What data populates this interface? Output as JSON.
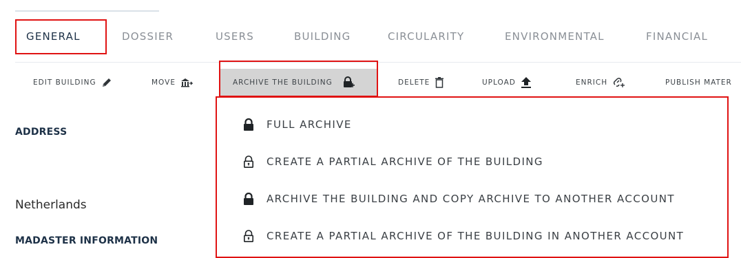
{
  "tabs": [
    {
      "label": "GENERAL",
      "active": true
    },
    {
      "label": "DOSSIER",
      "active": false
    },
    {
      "label": "USERS",
      "active": false
    },
    {
      "label": "BUILDING",
      "active": false
    },
    {
      "label": "CIRCULARITY",
      "active": false
    },
    {
      "label": "ENVIRONMENTAL",
      "active": false
    },
    {
      "label": "FINANCIAL",
      "active": false
    }
  ],
  "toolbar": {
    "edit_building": {
      "label": "EDIT BUILDING",
      "icon": "pencil-icon"
    },
    "move": {
      "label": "MOVE",
      "icon": "move-building-icon"
    },
    "archive": {
      "label": "ARCHIVE THE BUILDING",
      "icon": "lock-plus-icon"
    },
    "delete": {
      "label": "DELETE",
      "icon": "trash-icon"
    },
    "upload": {
      "label": "UPLOAD",
      "icon": "upload-arrow-icon"
    },
    "enrich": {
      "label": "ENRICH",
      "icon": "enrich-link-icon"
    },
    "publish": {
      "label": "PUBLISH MATER",
      "icon": ""
    }
  },
  "left": {
    "address_heading": "ADDRESS",
    "country": "Netherlands",
    "madaster_heading": "MADASTER INFORMATION"
  },
  "archive_menu": {
    "items": [
      {
        "label": "FULL ARCHIVE",
        "icon": "lock-closed-icon"
      },
      {
        "label": "CREATE A PARTIAL ARCHIVE OF THE BUILDING",
        "icon": "lock-open-icon"
      },
      {
        "label": "ARCHIVE THE BUILDING AND COPY ARCHIVE TO ANOTHER ACCOUNT",
        "icon": "lock-closed-icon"
      },
      {
        "label": "CREATE A PARTIAL ARCHIVE OF THE BUILDING IN ANOTHER ACCOUNT",
        "icon": "lock-open-icon"
      }
    ]
  },
  "colors": {
    "highlight": "#e01212",
    "heading": "#1d3147",
    "tab_inactive": "#8a8f96",
    "active_tool_bg": "#d4d4d4"
  }
}
